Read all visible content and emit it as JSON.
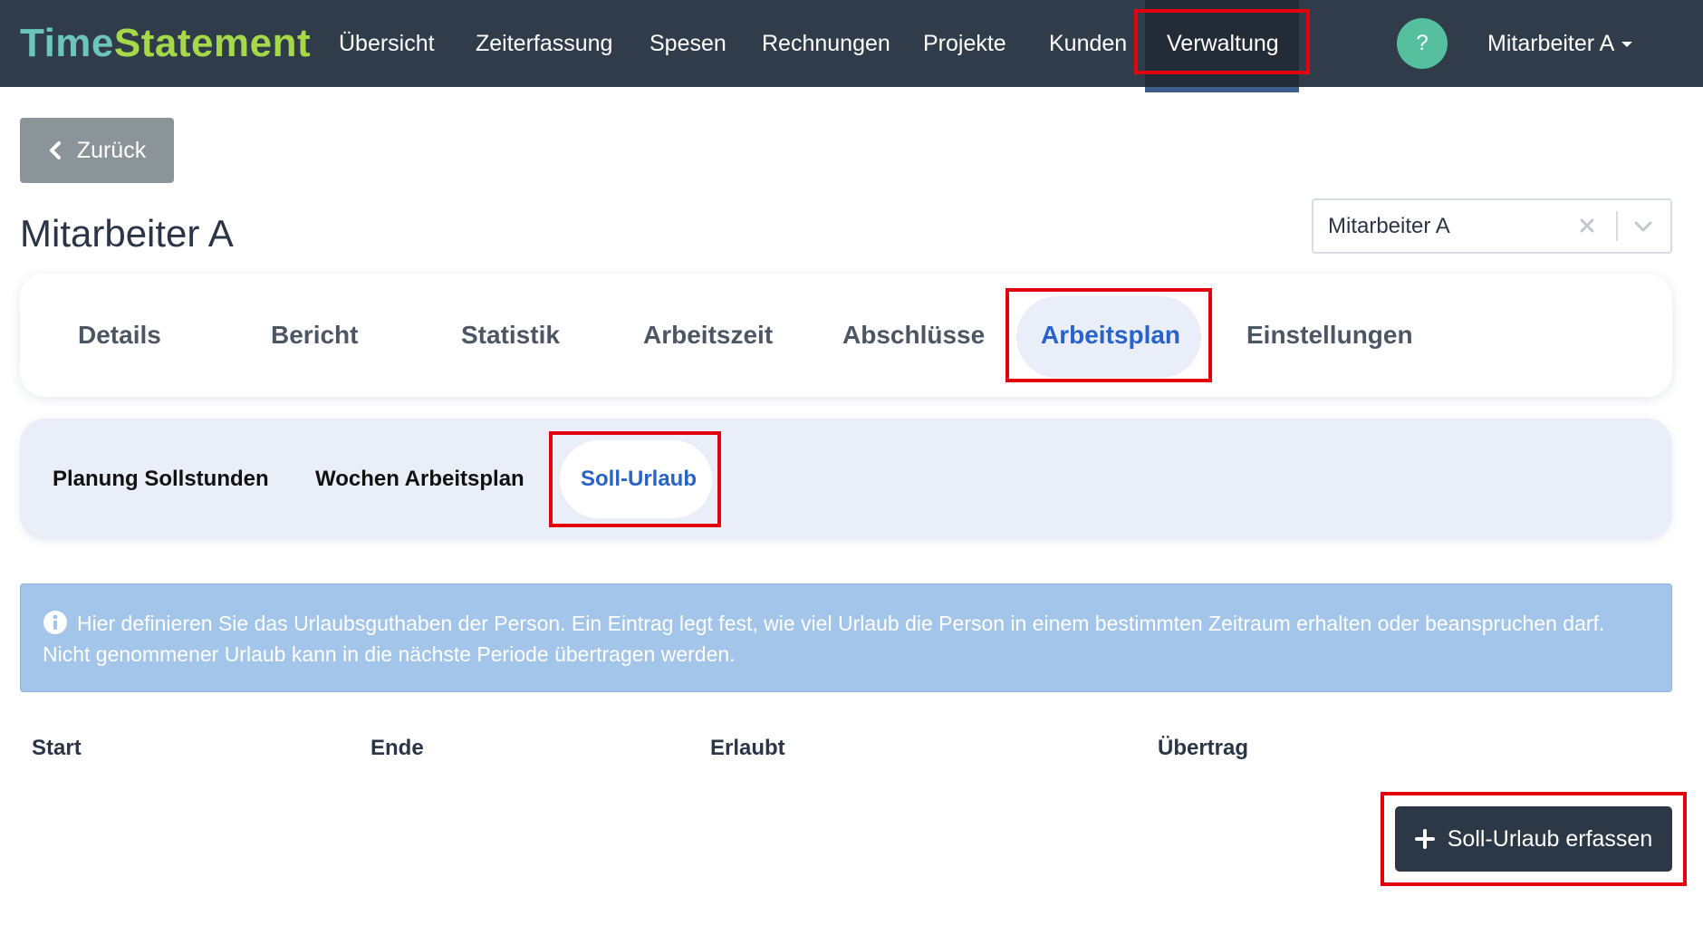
{
  "header": {
    "logo_part1": "Time",
    "logo_part2": "Statement",
    "nav": [
      {
        "label": "Übersicht"
      },
      {
        "label": "Zeiterfassung"
      },
      {
        "label": "Spesen"
      },
      {
        "label": "Rechnungen"
      },
      {
        "label": "Projekte"
      },
      {
        "label": "Kunden"
      },
      {
        "label": "Verwaltung",
        "active": true
      }
    ],
    "help_label": "?",
    "user_label": "Mitarbeiter A"
  },
  "back_button": {
    "label": "Zurück"
  },
  "page_title": "Mitarbeiter A",
  "employee_select": {
    "value": "Mitarbeiter A"
  },
  "tabs": [
    {
      "label": "Details"
    },
    {
      "label": "Bericht"
    },
    {
      "label": "Statistik"
    },
    {
      "label": "Arbeitszeit"
    },
    {
      "label": "Abschlüsse"
    },
    {
      "label": "Arbeitsplan",
      "active": true
    },
    {
      "label": "Einstellungen"
    }
  ],
  "subtabs": [
    {
      "label": "Planung Sollstunden"
    },
    {
      "label": "Wochen Arbeitsplan"
    },
    {
      "label": "Soll-Urlaub",
      "active": true
    }
  ],
  "info_alert": {
    "text": "Hier definieren Sie das Urlaubsguthaben der Person. Ein Eintrag legt fest, wie viel Urlaub die Person in einem bestimmten Zeitraum erhalten oder beanspruchen darf. Nicht genommener Urlaub kann in die nächste Periode übertragen werden."
  },
  "table": {
    "columns": [
      "Start",
      "Ende",
      "Erlaubt",
      "Übertrag"
    ]
  },
  "add_button": {
    "label": "Soll-Urlaub erfassen"
  },
  "colors": {
    "topbar": "#313c4b",
    "accent_blue": "#2962c8",
    "highlight_red": "#e3000f",
    "help_green": "#55bf9e",
    "alert_blue": "#a3c5e9"
  }
}
